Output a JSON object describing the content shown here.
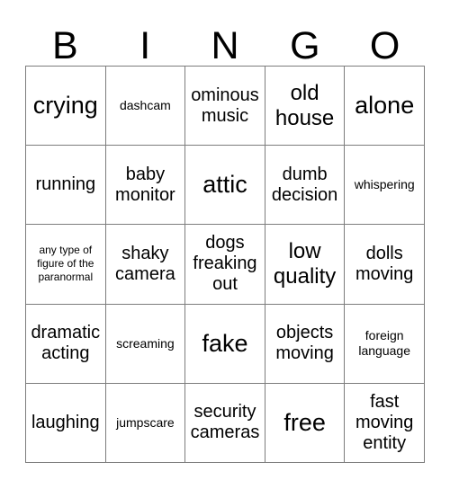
{
  "card": {
    "title_letters": [
      "B",
      "I",
      "N",
      "G",
      "O"
    ],
    "grid_color": "#7d7d7d",
    "text_color": "#000000",
    "background_color": "#ffffff",
    "columns": 5,
    "rows": 5,
    "cells": [
      {
        "text": "crying",
        "size": "fs-xl"
      },
      {
        "text": "dashcam",
        "size": "fs-xs"
      },
      {
        "text": "ominous music",
        "size": "fs-md"
      },
      {
        "text": "old house",
        "size": "fs-lg"
      },
      {
        "text": "alone",
        "size": "fs-xl"
      },
      {
        "text": "running",
        "size": "fs-md"
      },
      {
        "text": "baby monitor",
        "size": "fs-md"
      },
      {
        "text": "attic",
        "size": "fs-xl"
      },
      {
        "text": "dumb decision",
        "size": "fs-md"
      },
      {
        "text": "whispering",
        "size": "fs-xs"
      },
      {
        "text": "any type of figure of the paranormal",
        "size": "fs-xxs"
      },
      {
        "text": "shaky camera",
        "size": "fs-md"
      },
      {
        "text": "dogs freaking out",
        "size": "fs-md"
      },
      {
        "text": "low quality",
        "size": "fs-lg"
      },
      {
        "text": "dolls moving",
        "size": "fs-md"
      },
      {
        "text": "dramatic acting",
        "size": "fs-md"
      },
      {
        "text": "screaming",
        "size": "fs-xs"
      },
      {
        "text": "fake",
        "size": "fs-xl"
      },
      {
        "text": "objects moving",
        "size": "fs-md"
      },
      {
        "text": "foreign language",
        "size": "fs-xs"
      },
      {
        "text": "laughing",
        "size": "fs-md"
      },
      {
        "text": "jumpscare",
        "size": "fs-xs"
      },
      {
        "text": "security cameras",
        "size": "fs-md"
      },
      {
        "text": "free",
        "size": "fs-xl"
      },
      {
        "text": "fast moving entity",
        "size": "fs-md"
      }
    ]
  }
}
